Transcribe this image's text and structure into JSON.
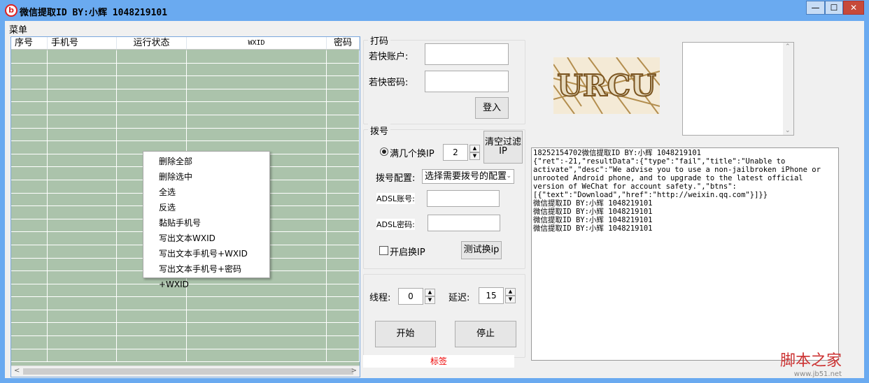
{
  "window": {
    "title": "微信提取ID BY:小辉 1048219101",
    "minimize": "—",
    "maximize": "☐",
    "close": "✕"
  },
  "menu": {
    "label": "菜单"
  },
  "table": {
    "columns": [
      "序号",
      "手机号",
      "运行状态",
      "WXID",
      "密码"
    ],
    "row_count": 24
  },
  "context_menu": [
    "删除全部",
    "删除选中",
    "全选",
    "反选",
    "黏贴手机号",
    "写出文本WXID",
    "写出文本手机号+WXID",
    "写出文本手机号+密码+WXID"
  ],
  "captcha_group": {
    "title": "打码",
    "account_label": "若快账户:",
    "account_value": "",
    "password_label": "若快密码:",
    "password_value": "",
    "login": "登入"
  },
  "captcha_text": "URCU",
  "dial_group": {
    "title": "拨号",
    "radio_label": "满几个换IP",
    "count": "2",
    "clear_button": "清空过滤IP",
    "config_label": "拨号配置:",
    "config_value": "选择需要拨号的配置",
    "adsl_account_label": "ADSL账号:",
    "adsl_account_value": "",
    "adsl_password_label": "ADSL密码:",
    "adsl_password_value": "",
    "enable_label": "开启换IP",
    "test_button": "测试换ip"
  },
  "run_group": {
    "threads_label": "线程:",
    "threads_value": "0",
    "delay_label": "延迟:",
    "delay_value": "15",
    "start": "开始",
    "stop": "停止",
    "status_label": "标签"
  },
  "log": "18252154702微信提取ID BY:小辉 1048219101\n{\"ret\":-21,\"resultData\":{\"type\":\"fail\",\"title\":\"Unable to activate\",\"desc\":\"We advise you to use a non-jailbroken iPhone or unrooted Android phone, and to upgrade to the latest official version of WeChat for account safety.\",\"btns\":\n[{\"text\":\"Download\",\"href\":\"http://weixin.qq.com\"}]}}\n微信提取ID BY:小辉 1048219101\n微信提取ID BY:小辉 1048219101\n微信提取ID BY:小辉 1048219101\n微信提取ID BY:小辉 1048219101",
  "watermark": {
    "name": "脚本之家",
    "url": "www.jb51.net"
  }
}
